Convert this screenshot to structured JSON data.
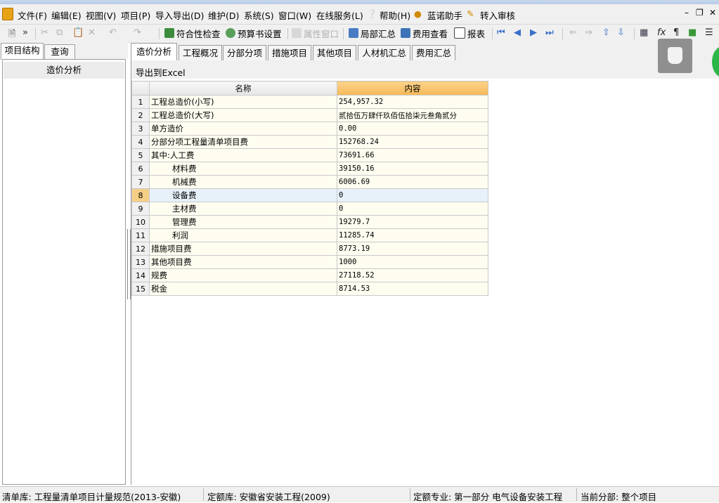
{
  "menu": {
    "file": "文件(F)",
    "edit": "编辑(E)",
    "view": "视图(V)",
    "project": "项目(P)",
    "import_export": "导入导出(D)",
    "maintain": "维护(D)",
    "system": "系统(S)",
    "window": "窗口(W)",
    "online": "在线服务(L)",
    "help": "帮助(H)",
    "assistant": "蓝诺助手",
    "review": "转入审核"
  },
  "toolbar": {
    "compliance_check": "符合性检查",
    "budget_setting": "预算书设置",
    "property_window": "属性窗口",
    "partial_summary": "局部汇总",
    "fee_view": "费用查看",
    "report": "报表"
  },
  "left_tabs": [
    "项目结构",
    "查询"
  ],
  "left_tree": {
    "item": "造价分析"
  },
  "right_tabs": [
    "造价分析",
    "工程概况",
    "分部分项",
    "措施项目",
    "其他项目",
    "人材机汇总",
    "费用汇总"
  ],
  "export_label": "导出到Excel",
  "grid": {
    "col_name": "名称",
    "col_content": "内容",
    "rows": [
      {
        "no": "1",
        "name": "工程总造价(小写)",
        "value": "254,957.32"
      },
      {
        "no": "2",
        "name": "工程总造价(大写)",
        "value": "贰拾伍万肆仟玖佰伍拾柒元叁角贰分"
      },
      {
        "no": "3",
        "name": "单方造价",
        "value": "0.00"
      },
      {
        "no": "4",
        "name": "分部分项工程量清单项目费",
        "value": "152768.24"
      },
      {
        "no": "5",
        "name": "其中:人工费",
        "value": "73691.66"
      },
      {
        "no": "6",
        "name": "材料费",
        "value": "39150.16"
      },
      {
        "no": "7",
        "name": "机械费",
        "value": "6006.69"
      },
      {
        "no": "8",
        "name": "设备费",
        "value": "0"
      },
      {
        "no": "9",
        "name": "主材费",
        "value": "0"
      },
      {
        "no": "10",
        "name": "管理费",
        "value": "19279.7"
      },
      {
        "no": "11",
        "name": "利润",
        "value": "11285.74"
      },
      {
        "no": "12",
        "name": "措施项目费",
        "value": "8773.19"
      },
      {
        "no": "13",
        "name": "其他项目费",
        "value": "1000"
      },
      {
        "no": "14",
        "name": "规费",
        "value": "27118.52"
      },
      {
        "no": "15",
        "name": "税金",
        "value": "8714.53"
      }
    ]
  },
  "status": {
    "list_lib": "清单库: 工程量清单项目计量规范(2013-安徽)",
    "quota_lib": "定额库: 安徽省安装工程(2009)",
    "quota_major": "定额专业: 第一部分 电气设备安装工程",
    "current_part": "当前分部: 整个项目"
  },
  "colors": {
    "selected_header": "#f5b858",
    "row_bg": "#fffdf0",
    "current_row": "#e6f1fa"
  }
}
